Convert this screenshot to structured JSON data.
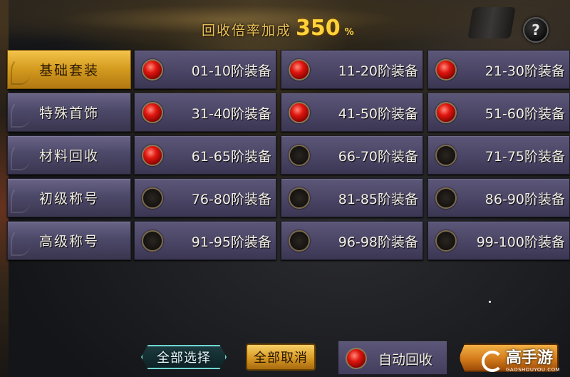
{
  "header": {
    "label": "回收倍率加成",
    "rate": "350",
    "unit": "%"
  },
  "help_button": {
    "label": "?"
  },
  "sidebar": {
    "tabs": [
      {
        "label": "基础套装",
        "active": true
      },
      {
        "label": "特殊首饰",
        "active": false
      },
      {
        "label": "材料回收",
        "active": false
      },
      {
        "label": "初级称号",
        "active": false
      },
      {
        "label": "高级称号",
        "active": false
      }
    ]
  },
  "grid": {
    "cells": [
      {
        "label": "01-10阶装备",
        "checked": true
      },
      {
        "label": "11-20阶装备",
        "checked": true
      },
      {
        "label": "21-30阶装备",
        "checked": true
      },
      {
        "label": "31-40阶装备",
        "checked": true
      },
      {
        "label": "41-50阶装备",
        "checked": true
      },
      {
        "label": "51-60阶装备",
        "checked": true
      },
      {
        "label": "61-65阶装备",
        "checked": true
      },
      {
        "label": "66-70阶装备",
        "checked": false
      },
      {
        "label": "71-75阶装备",
        "checked": false
      },
      {
        "label": "76-80阶装备",
        "checked": false
      },
      {
        "label": "81-85阶装备",
        "checked": false
      },
      {
        "label": "86-90阶装备",
        "checked": false
      },
      {
        "label": "91-95阶装备",
        "checked": false
      },
      {
        "label": "96-98阶装备",
        "checked": false
      },
      {
        "label": "99-100阶装备",
        "checked": false
      }
    ]
  },
  "footer": {
    "select_all": "全部选择",
    "cancel_all": "全部取消",
    "auto_recycle": "自动回收",
    "auto_recycle_checked": true
  },
  "watermark": {
    "main": "高手游",
    "sub": "GAOSHOUYOU.COM"
  },
  "colors": {
    "gold": "#ffd23a",
    "active_tab": "#d29a1e",
    "cell_bg": "#4a4565",
    "checked_dot": "#e0160f",
    "teal_border": "#6fd6d2"
  }
}
